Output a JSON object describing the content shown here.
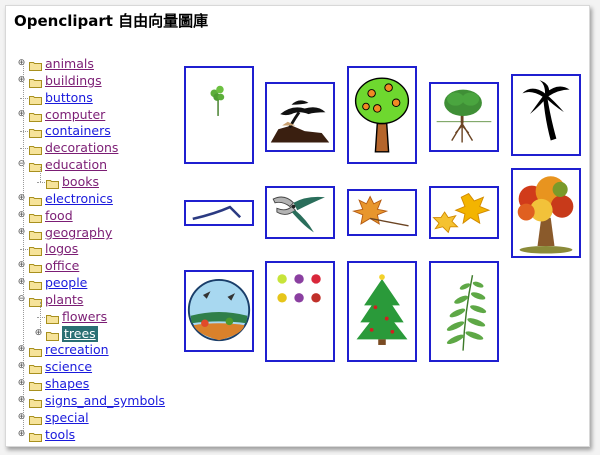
{
  "page": {
    "title": "Openclipart 自由向量圖庫"
  },
  "tree": {
    "items": [
      {
        "label": "animals",
        "expander": "plus",
        "state": "visited"
      },
      {
        "label": "buildings",
        "expander": "plus",
        "state": "visited"
      },
      {
        "label": "buttons",
        "expander": "none",
        "state": "unvisited"
      },
      {
        "label": "computer",
        "expander": "plus",
        "state": "visited"
      },
      {
        "label": "containers",
        "expander": "none",
        "state": "unvisited"
      },
      {
        "label": "decorations",
        "expander": "none",
        "state": "visited"
      },
      {
        "label": "education",
        "expander": "minus",
        "state": "visited"
      },
      {
        "label": "books",
        "expander": "none",
        "state": "visited",
        "child": true
      },
      {
        "label": "electronics",
        "expander": "plus",
        "state": "unvisited"
      },
      {
        "label": "food",
        "expander": "plus",
        "state": "visited"
      },
      {
        "label": "geography",
        "expander": "plus",
        "state": "visited"
      },
      {
        "label": "logos",
        "expander": "none",
        "state": "visited"
      },
      {
        "label": "office",
        "expander": "plus",
        "state": "visited"
      },
      {
        "label": "people",
        "expander": "plus",
        "state": "unvisited"
      },
      {
        "label": "plants",
        "expander": "minus",
        "state": "visited"
      },
      {
        "label": "flowers",
        "expander": "none",
        "state": "visited",
        "child": true
      },
      {
        "label": "trees",
        "expander": "plus",
        "state": "selected",
        "child": true
      },
      {
        "label": "recreation",
        "expander": "plus",
        "state": "unvisited"
      },
      {
        "label": "science",
        "expander": "plus",
        "state": "unvisited"
      },
      {
        "label": "shapes",
        "expander": "plus",
        "state": "unvisited"
      },
      {
        "label": "signs_and_symbols",
        "expander": "plus",
        "state": "unvisited"
      },
      {
        "label": "special",
        "expander": "plus",
        "state": "unvisited"
      },
      {
        "label": "tools",
        "expander": "plus",
        "state": "unvisited"
      }
    ]
  },
  "gallery": {
    "items": [
      {
        "name": "small-sapling",
        "icon": "sapling-icon"
      },
      {
        "name": "bonsai-on-rock",
        "icon": "bonsai-silhouette-icon"
      },
      {
        "name": "fruit-tree",
        "icon": "fruit-tree-icon"
      },
      {
        "name": "tree-with-roots",
        "icon": "tree-roots-icon"
      },
      {
        "name": "palm-tree",
        "icon": "palm-silhouette-icon"
      },
      {
        "name": "branch",
        "icon": "branch-icon"
      },
      {
        "name": "pruning-shears",
        "icon": "pruning-shears-icon"
      },
      {
        "name": "maple-leaf",
        "icon": "maple-leaf-icon"
      },
      {
        "name": "autumn-leaves",
        "icon": "autumn-leaves-icon"
      },
      {
        "name": "autumn-tree",
        "icon": "autumn-tree-icon"
      },
      {
        "name": "park-scene-circle",
        "icon": "park-scene-icon"
      },
      {
        "name": "ornament-balls",
        "icon": "ornament-balls-icon"
      },
      {
        "name": "christmas-tree",
        "icon": "christmas-tree-icon"
      },
      {
        "name": "fern-leaf",
        "icon": "fern-leaf-icon"
      }
    ]
  },
  "colors": {
    "link": "#1a1adc",
    "visited": "#7b1d74",
    "selected_bg": "#2a6f73",
    "thumb_border": "#1f1fd0"
  }
}
